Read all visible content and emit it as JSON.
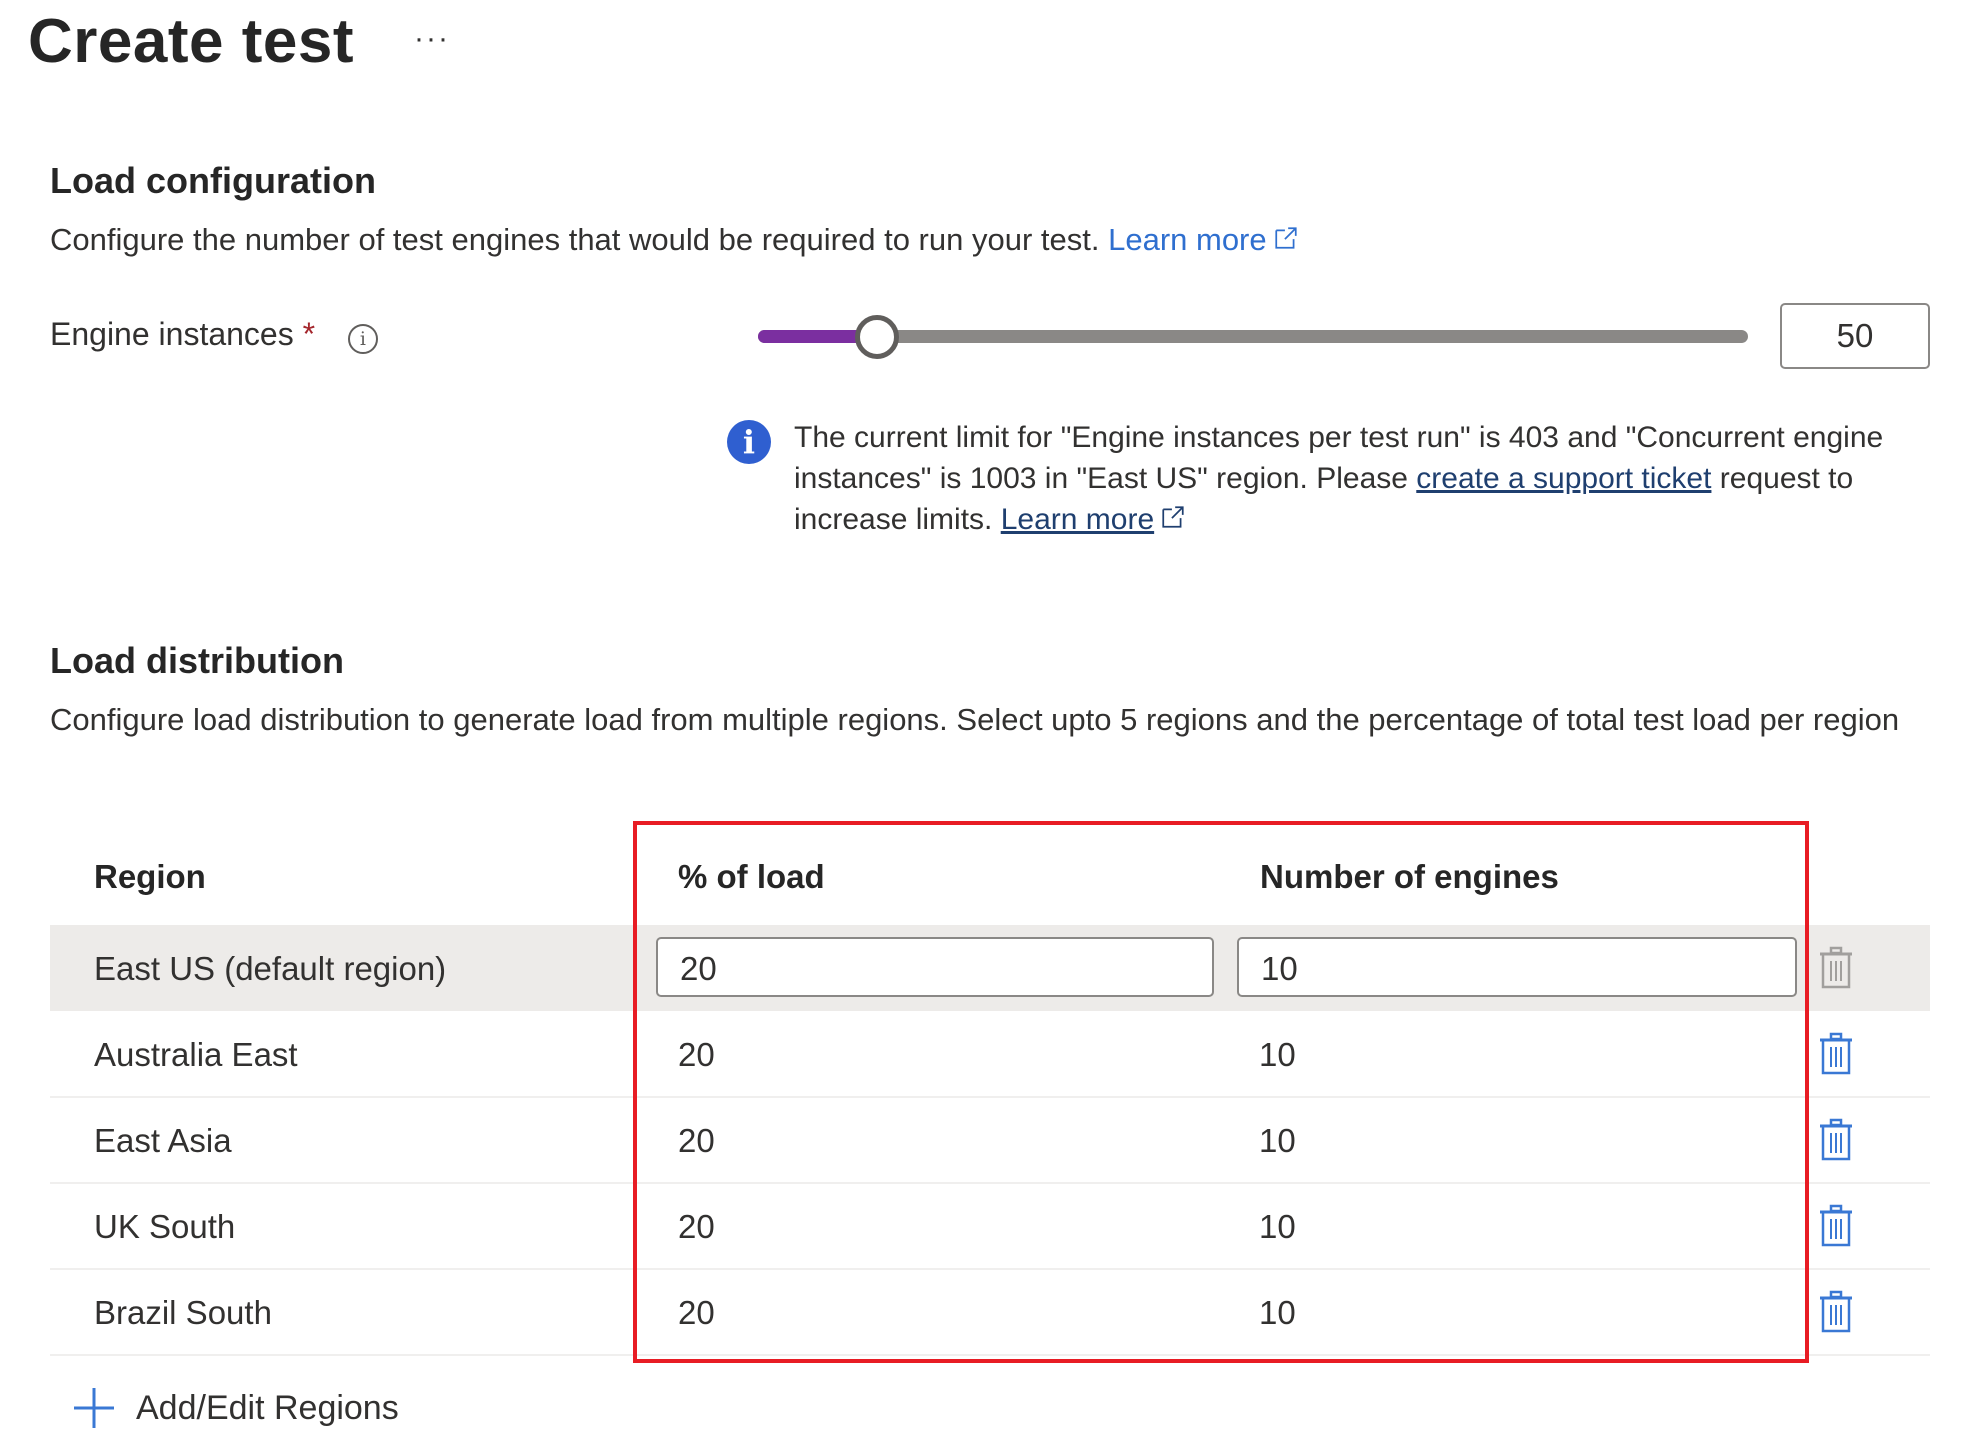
{
  "page": {
    "title": "Create test",
    "more_label": "···"
  },
  "load_configuration": {
    "heading": "Load configuration",
    "description": "Configure the number of test engines that would be required to run your test.",
    "learn_more": "Learn more",
    "engine_instances": {
      "label": "Engine instances",
      "required_marker": "*",
      "value": "50",
      "slider_fraction": 0.12
    },
    "info": {
      "text_before_link": "The current limit for \"Engine instances per test run\" is 403 and \"Concurrent engine instances\" is 1003 in \"East US\" region. Please ",
      "support_link": "create a support ticket",
      "text_after_link": " request to increase limits. ",
      "learn_more": "Learn more"
    }
  },
  "load_distribution": {
    "heading": "Load distribution",
    "description": "Configure load distribution to generate load from multiple regions. Select upto 5 regions and the percentage of total test load per region",
    "columns": {
      "region": "Region",
      "percent": "% of load",
      "engines": "Number of engines"
    },
    "rows": [
      {
        "region": "East US (default region)",
        "percent": "20",
        "engines": "10",
        "editable": true
      },
      {
        "region": "Australia East",
        "percent": "20",
        "engines": "10"
      },
      {
        "region": "East Asia",
        "percent": "20",
        "engines": "10"
      },
      {
        "region": "UK South",
        "percent": "20",
        "engines": "10"
      },
      {
        "region": "Brazil South",
        "percent": "20",
        "engines": "10"
      }
    ],
    "add_edit_label": "Add/Edit Regions"
  },
  "colors": {
    "accent_link": "#2f6fcf",
    "slider_fill": "#7b2fa0",
    "info_icon": "#2f5fd0",
    "highlight_box": "#e81c24",
    "trash_active": "#3a78d4",
    "trash_disabled": "#a19f9d"
  }
}
